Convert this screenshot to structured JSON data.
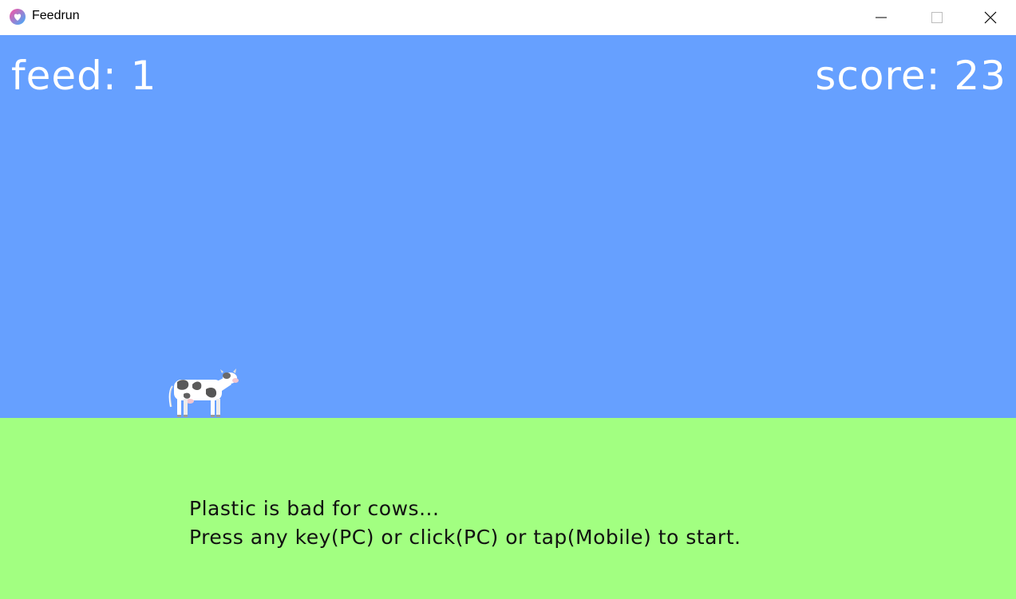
{
  "window": {
    "title": "Feedrun",
    "icon": "feedrun-app-icon",
    "controls": [
      "minimize-icon",
      "maximize-icon",
      "close-icon"
    ]
  },
  "colors": {
    "sky": "#66a0ff",
    "ground": "#a2ff81",
    "hud_text": "#ffffff",
    "message_text": "#111111"
  },
  "hud": {
    "feed_text": "feed: 1",
    "score_text": "score: 23"
  },
  "game": {
    "player_sprite": "cow-sprite",
    "messages": [
      "Plastic is bad for cows...",
      "Press any key(PC) or click(PC) or tap(Mobile) to start."
    ]
  }
}
